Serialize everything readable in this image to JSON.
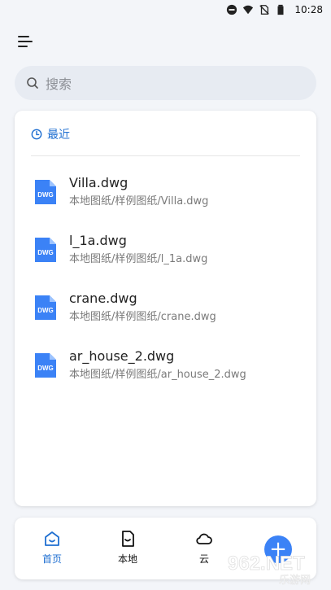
{
  "status_bar": {
    "time": "10:28",
    "icons": [
      "do-not-disturb-icon",
      "wifi-icon",
      "no-sim-icon",
      "battery-icon"
    ]
  },
  "header": {
    "menu_icon": "menu-icon"
  },
  "search": {
    "placeholder": "搜索",
    "icon": "search-icon"
  },
  "recent": {
    "title": "最近",
    "icon": "clock-icon",
    "files": [
      {
        "name": "Villa.dwg",
        "path": "本地图纸/样例图纸/Villa.dwg",
        "type": "DWG"
      },
      {
        "name": "l_1a.dwg",
        "path": "本地图纸/样例图纸/l_1a.dwg",
        "type": "DWG"
      },
      {
        "name": "crane.dwg",
        "path": "本地图纸/样例图纸/crane.dwg",
        "type": "DWG"
      },
      {
        "name": "ar_house_2.dwg",
        "path": "本地图纸/样例图纸/ar_house_2.dwg",
        "type": "DWG"
      }
    ]
  },
  "bottom_nav": {
    "items": [
      {
        "label": "首页",
        "icon": "home-icon",
        "active": true
      },
      {
        "label": "本地",
        "icon": "local-file-icon",
        "active": false
      },
      {
        "label": "云",
        "icon": "cloud-icon",
        "active": false
      }
    ],
    "fab": {
      "icon": "plus-icon",
      "label": "+"
    }
  },
  "watermark": {
    "text_top": "962.NET",
    "text_bottom": "乐游网"
  },
  "colors": {
    "accent": "#1f6fd1",
    "fab": "#3b82f6",
    "file_icon": "#3b82f6",
    "background": "#f3f5f9"
  }
}
